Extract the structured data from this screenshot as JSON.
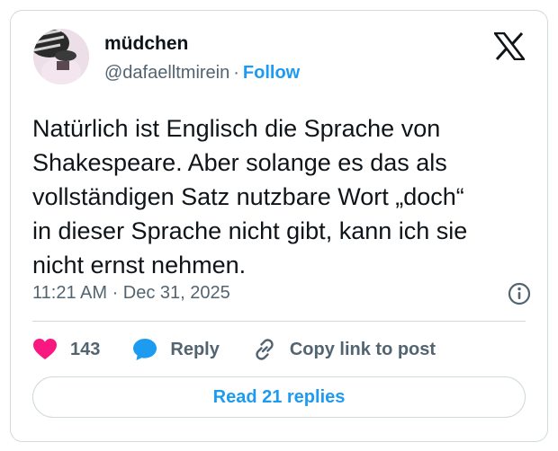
{
  "author": {
    "display_name": "müdchen",
    "handle": "@dafaelltmirein",
    "separator": "·",
    "follow_label": "Follow"
  },
  "tweet": {
    "text_lines": [
      "Natürlich ist Englisch die Sprache von",
      "Shakespeare. Aber solange es das als",
      "vollständigen Satz nutzbare Wort „doch“",
      "in dieser Sprache nicht gibt, kann ich sie",
      "nicht ernst nehmen."
    ],
    "timestamp": "11:21 AM · Dec 31, 2025"
  },
  "actions": {
    "likes_count": "143",
    "reply_label": "Reply",
    "copy_link_label": "Copy link to post"
  },
  "footer": {
    "read_replies_label": "Read 21 replies"
  },
  "icons": {
    "brand": "x-logo-icon",
    "info": "info-icon",
    "like": "heart-icon",
    "reply": "speech-bubble-icon",
    "copy": "link-icon"
  },
  "colors": {
    "accent": "#1d9bf0",
    "like": "#f91880",
    "text": "#0f1419",
    "muted": "#536471",
    "border": "#cfd9de"
  }
}
